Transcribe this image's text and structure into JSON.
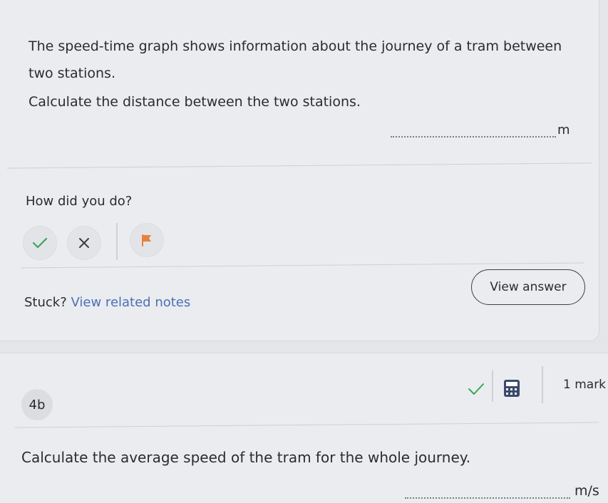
{
  "question_a": {
    "text": "The speed-time graph shows information about the journey of a tram between two stations.",
    "instruction": "Calculate the distance between the two stations.",
    "unit": "m"
  },
  "feedback": {
    "prompt": "How did you do?",
    "correct_icon": "check-icon",
    "wrong_icon": "cross-icon",
    "flag_icon": "flag-icon"
  },
  "help": {
    "stuck": "Stuck?",
    "notes_link": "View related notes",
    "view_answer": "View answer"
  },
  "question_b": {
    "number": "4b",
    "marks": "1 mark",
    "text": "Calculate the average speed of the tram for the whole journey.",
    "unit": "m/s"
  },
  "colors": {
    "accent_green": "#3aa657",
    "accent_flag": "#e8813a",
    "link_blue": "#4a6fb6"
  }
}
